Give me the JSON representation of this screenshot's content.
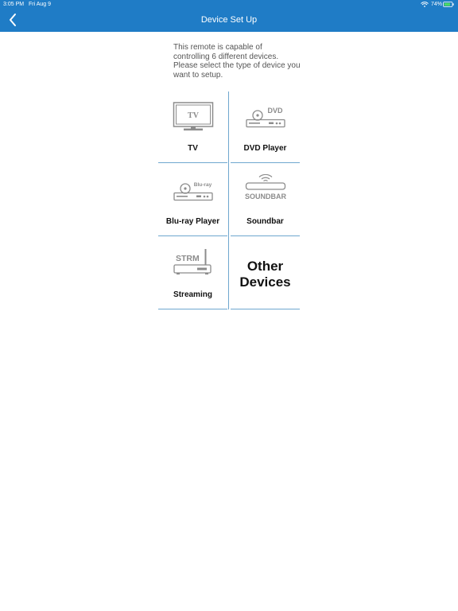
{
  "status_bar": {
    "time": "3:05 PM",
    "date": "Fri Aug 9",
    "battery": "74%"
  },
  "nav": {
    "title": "Device Set Up",
    "back_icon": "chevron-left-icon"
  },
  "intro_text": "This remote is capable of controlling 6 different devices. Please select the type of device you want to setup.",
  "devices": [
    {
      "label": "TV",
      "icon_text": "TV",
      "icon": "tv-icon"
    },
    {
      "label": "DVD Player",
      "icon_text": "DVD",
      "icon": "dvd-player-icon"
    },
    {
      "label": "Blu-ray Player",
      "icon_text": "Blu-ray",
      "icon": "bluray-player-icon"
    },
    {
      "label": "Soundbar",
      "icon_text": "SOUNDBAR",
      "icon": "soundbar-icon"
    },
    {
      "label": "Streaming",
      "icon_text": "STRM",
      "icon": "streaming-icon"
    }
  ],
  "other_devices": {
    "line1": "Other",
    "line2": "Devices"
  },
  "colors": {
    "header": "#1f7cc6",
    "divider": "#6fa7cf",
    "icon": "#8c8c8c"
  }
}
